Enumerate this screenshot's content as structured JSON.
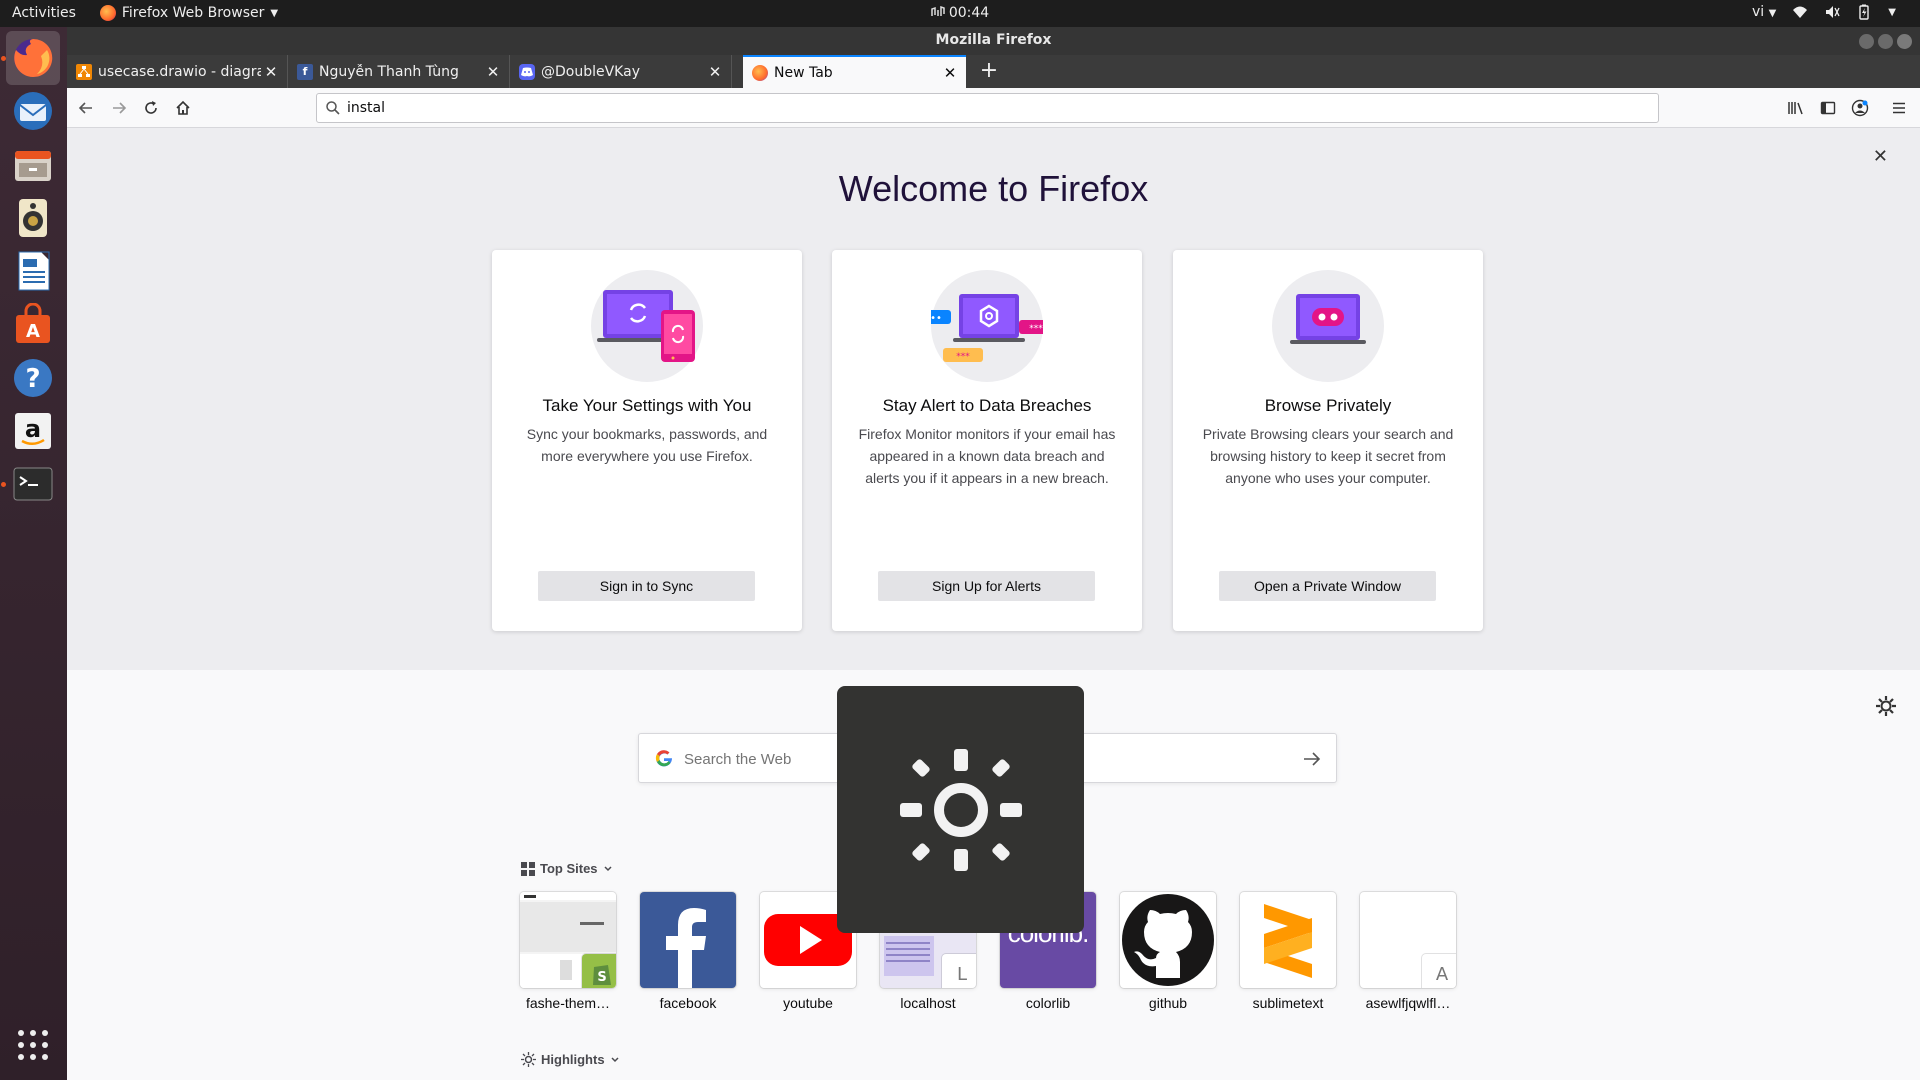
{
  "topbar": {
    "activities": "Activities",
    "app_menu": "Firefox Web Browser",
    "clock": "00:44",
    "language": "vi"
  },
  "window": {
    "title": "Mozilla Firefox"
  },
  "tabs": [
    {
      "title": "usecase.drawio - diagrams.net",
      "favicon": "drawio-icon"
    },
    {
      "title": "Nguyễn Thanh Tùng",
      "favicon": "facebook-icon"
    },
    {
      "title": "@DoubleVKay",
      "favicon": "discord-icon"
    },
    {
      "title": "New Tab",
      "favicon": "firefox-icon"
    }
  ],
  "urlbar": {
    "value": "instal"
  },
  "onboarding": {
    "title": "Welcome to Firefox",
    "cards": [
      {
        "title": "Take Your Settings with You",
        "text": "Sync your bookmarks, passwords, and more everywhere you use Firefox.",
        "button": "Sign in to Sync"
      },
      {
        "title": "Stay Alert to Data Breaches",
        "text": "Firefox Monitor monitors if your email has appeared in a known data breach and alerts you if it appears in a new breach.",
        "button": "Sign Up for Alerts"
      },
      {
        "title": "Browse Privately",
        "text": "Private Browsing clears your search and browsing history to keep it secret from anyone who uses your computer.",
        "button": "Open a Private Window"
      }
    ]
  },
  "search": {
    "placeholder": "Search the Web"
  },
  "top_sites": {
    "title": "Top Sites",
    "sites": [
      {
        "label": "fashe-them…"
      },
      {
        "label": "facebook"
      },
      {
        "label": "youtube"
      },
      {
        "label": "localhost",
        "letter": "L"
      },
      {
        "label": "colorlib",
        "logo_text": "colorlib."
      },
      {
        "label": "github"
      },
      {
        "label": "sublimetext"
      },
      {
        "label": "asewlfjqwlfl…",
        "letter": "A"
      }
    ]
  },
  "highlights": {
    "title": "Highlights"
  },
  "colors": {
    "accent_blue": "#0a84ff",
    "dock_bg": "#3d2a35",
    "ubuntu_orange": "#e95420",
    "firefox_purple": "#7542e5"
  }
}
